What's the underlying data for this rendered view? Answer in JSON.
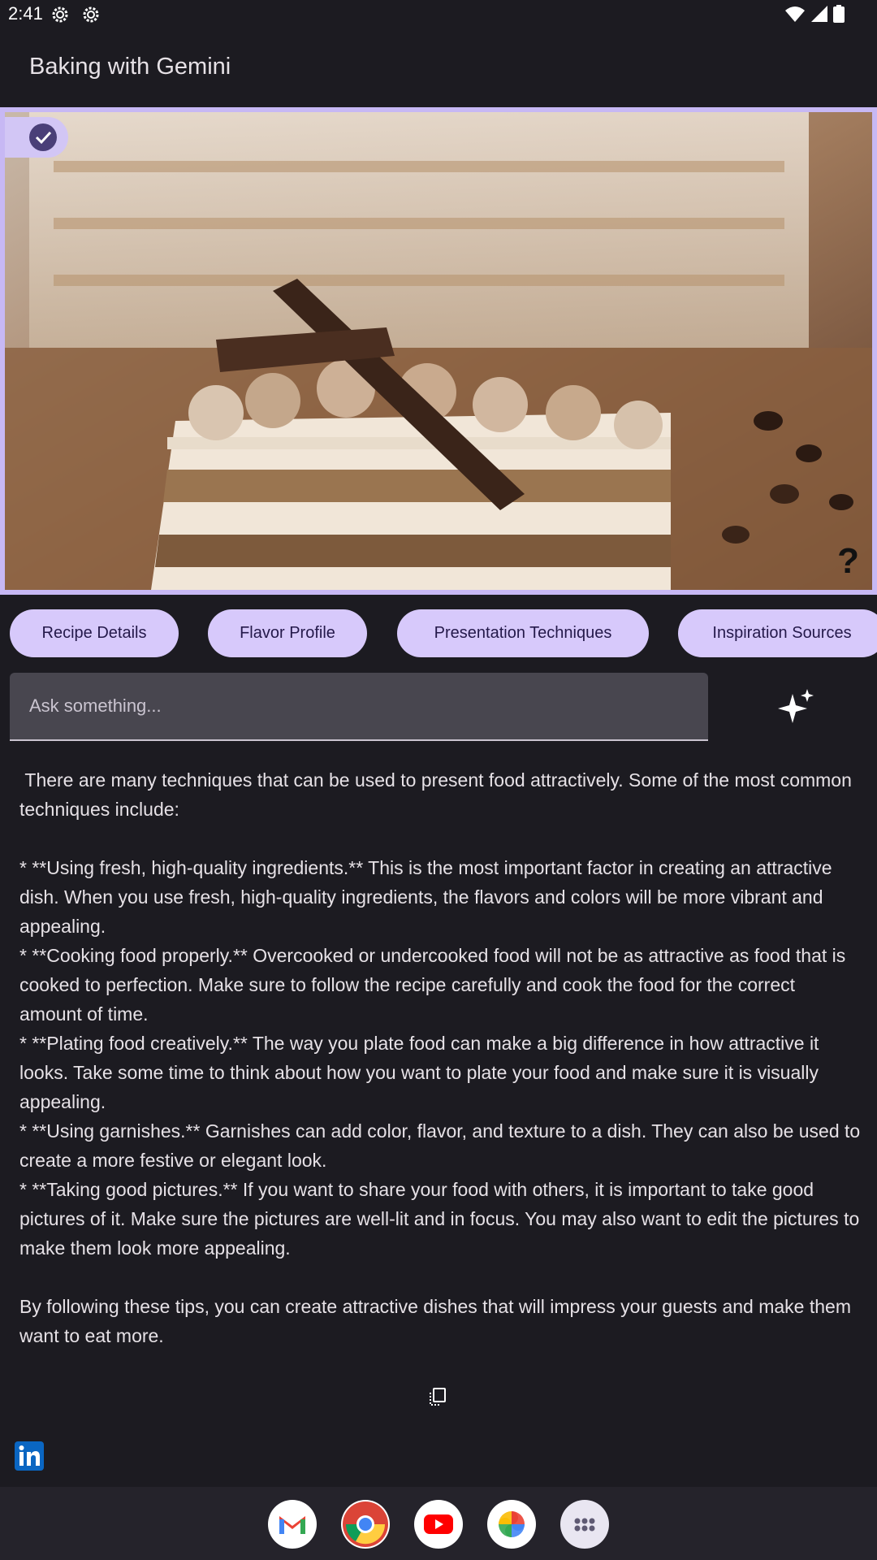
{
  "status_bar": {
    "time": "2:41"
  },
  "app_bar": {
    "title": "Baking with Gemini"
  },
  "image_panel": {
    "help_label": "?"
  },
  "chips": [
    {
      "label": "Recipe Details"
    },
    {
      "label": "Flavor Profile"
    },
    {
      "label": "Presentation Techniques"
    },
    {
      "label": "Inspiration Sources"
    }
  ],
  "ask": {
    "placeholder": "Ask something..."
  },
  "response": {
    "text": " There are many techniques that can be used to present food attractively. Some of the most common techniques include:\n\n* **Using fresh, high-quality ingredients.** This is the most important factor in creating an attractive dish. When you use fresh, high-quality ingredients, the flavors and colors will be more vibrant and appealing.\n* **Cooking food properly.** Overcooked or undercooked food will not be as attractive as food that is cooked to perfection. Make sure to follow the recipe carefully and cook the food for the correct amount of time.\n* **Plating food creatively.** The way you plate food can make a big difference in how attractive it looks. Take some time to think about how you want to plate your food and make sure it is visually appealing.\n* **Using garnishes.** Garnishes can add color, flavor, and texture to a dish. They can also be used to create a more festive or elegant look.\n* **Taking good pictures.** If you want to share your food with others, it is important to take good pictures of it. Make sure the pictures are well-lit and in focus. You may also want to edit the pictures to make them look more appealing.\n\nBy following these tips, you can create attractive dishes that will impress your guests and make them want to eat more."
  },
  "dock": {
    "apps": [
      {
        "icon": "gmail-icon"
      },
      {
        "icon": "chrome-icon"
      },
      {
        "icon": "youtube-icon"
      },
      {
        "icon": "photos-icon"
      },
      {
        "icon": "app-drawer-icon"
      }
    ]
  },
  "colors": {
    "background": "#1c1b21",
    "accent": "#c7b8f4",
    "chip": "#d7c9fb",
    "field": "#48464f"
  }
}
